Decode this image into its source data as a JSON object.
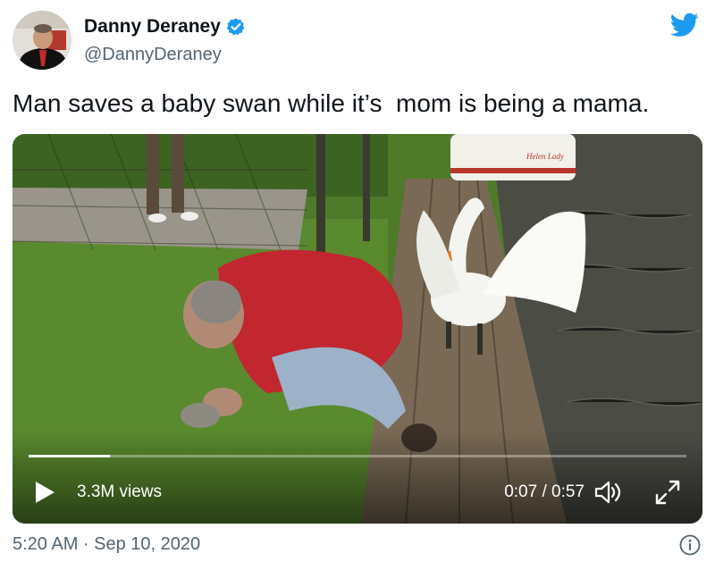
{
  "author": {
    "name": "Danny Deraney",
    "handle": "@DannyDeraney",
    "verified": true
  },
  "tweet": {
    "text": "Man saves a baby swan while it’s  mom is being a mama."
  },
  "video": {
    "views": "3.3M views",
    "time": "0:07 / 0:57",
    "progress": 0.123,
    "boat_lettering": "Helen Lady"
  },
  "meta": {
    "timestamp": "5:20 AM · Sep 10, 2020"
  },
  "icons": {
    "brand": "twitter-bird-icon",
    "verified": "verified-badge-icon",
    "play": "play-icon",
    "volume": "volume-icon",
    "fullscreen": "fullscreen-icon",
    "info": "info-icon"
  },
  "colors": {
    "twitter_blue": "#1d9bf0",
    "text": "#0f1419",
    "secondary_text": "#536471"
  }
}
